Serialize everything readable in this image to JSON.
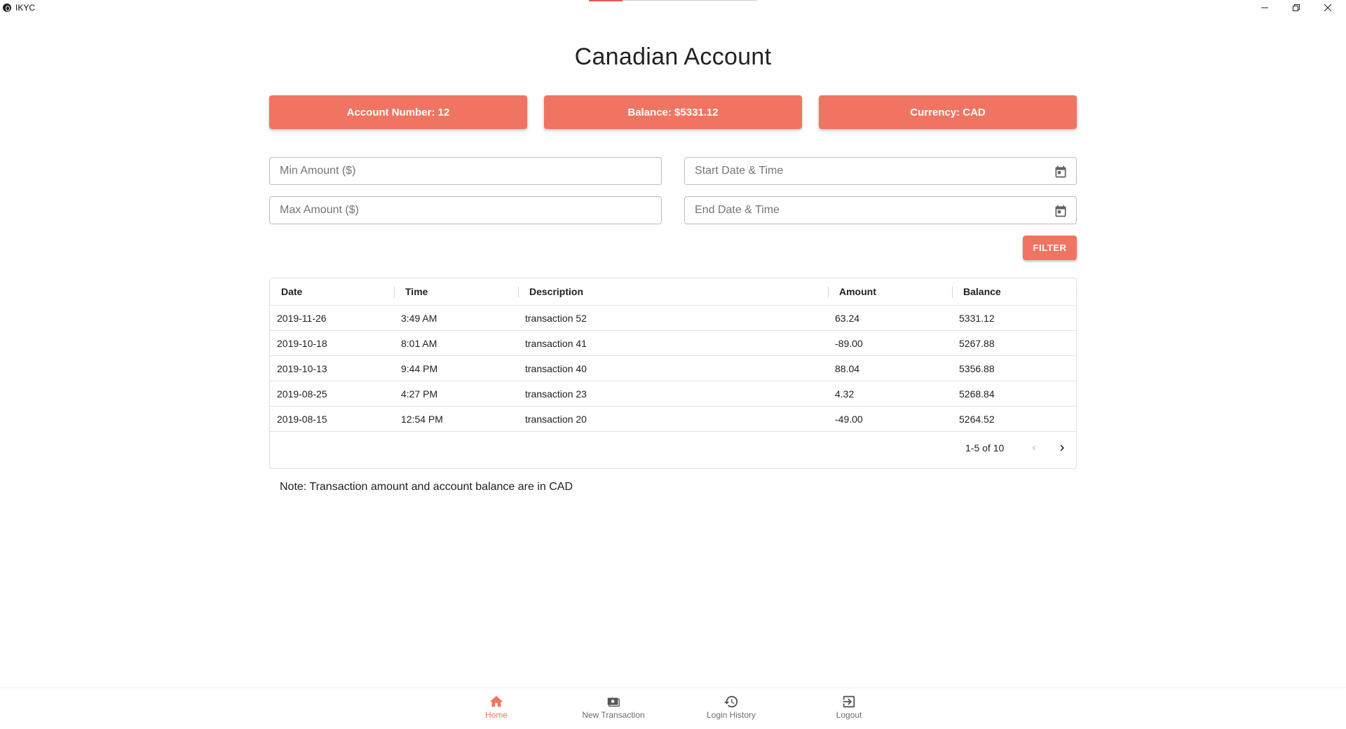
{
  "window": {
    "title": "IKYC",
    "controls": {
      "minimize": "—",
      "maximize": "❐",
      "close": "✕"
    }
  },
  "page": {
    "title": "Canadian Account"
  },
  "cards": {
    "account_number": "Account Number: 12",
    "balance": "Balance: $5331.12",
    "currency": "Currency: CAD"
  },
  "filters": {
    "min_amount_placeholder": "Min Amount ($)",
    "max_amount_placeholder": "Max Amount ($)",
    "start_date_placeholder": "Start Date & Time",
    "end_date_placeholder": "End Date & Time",
    "filter_button": "FILTER"
  },
  "table": {
    "headers": {
      "date": "Date",
      "time": "Time",
      "description": "Description",
      "amount": "Amount",
      "balance": "Balance"
    },
    "rows": [
      {
        "date": "2019-11-26",
        "time": "3:49 AM",
        "description": "transaction 52",
        "amount": "63.24",
        "balance": "5331.12"
      },
      {
        "date": "2019-10-18",
        "time": "8:01 AM",
        "description": "transaction 41",
        "amount": "-89.00",
        "balance": "5267.88"
      },
      {
        "date": "2019-10-13",
        "time": "9:44 PM",
        "description": "transaction 40",
        "amount": "88.04",
        "balance": "5356.88"
      },
      {
        "date": "2019-08-25",
        "time": "4:27 PM",
        "description": "transaction 23",
        "amount": "4.32",
        "balance": "5268.84"
      },
      {
        "date": "2019-08-15",
        "time": "12:54 PM",
        "description": "transaction 20",
        "amount": "-49.00",
        "balance": "5264.52"
      }
    ],
    "pagination": "1-5 of 10"
  },
  "note": "Note: Transaction amount and account balance are in CAD",
  "bottom_nav": {
    "home": "Home",
    "new_transaction": "New Transaction",
    "login_history": "Login History",
    "logout": "Logout"
  },
  "colors": {
    "accent": "#f07461",
    "text": "#212121",
    "nav_inactive": "#6d6d6d"
  }
}
